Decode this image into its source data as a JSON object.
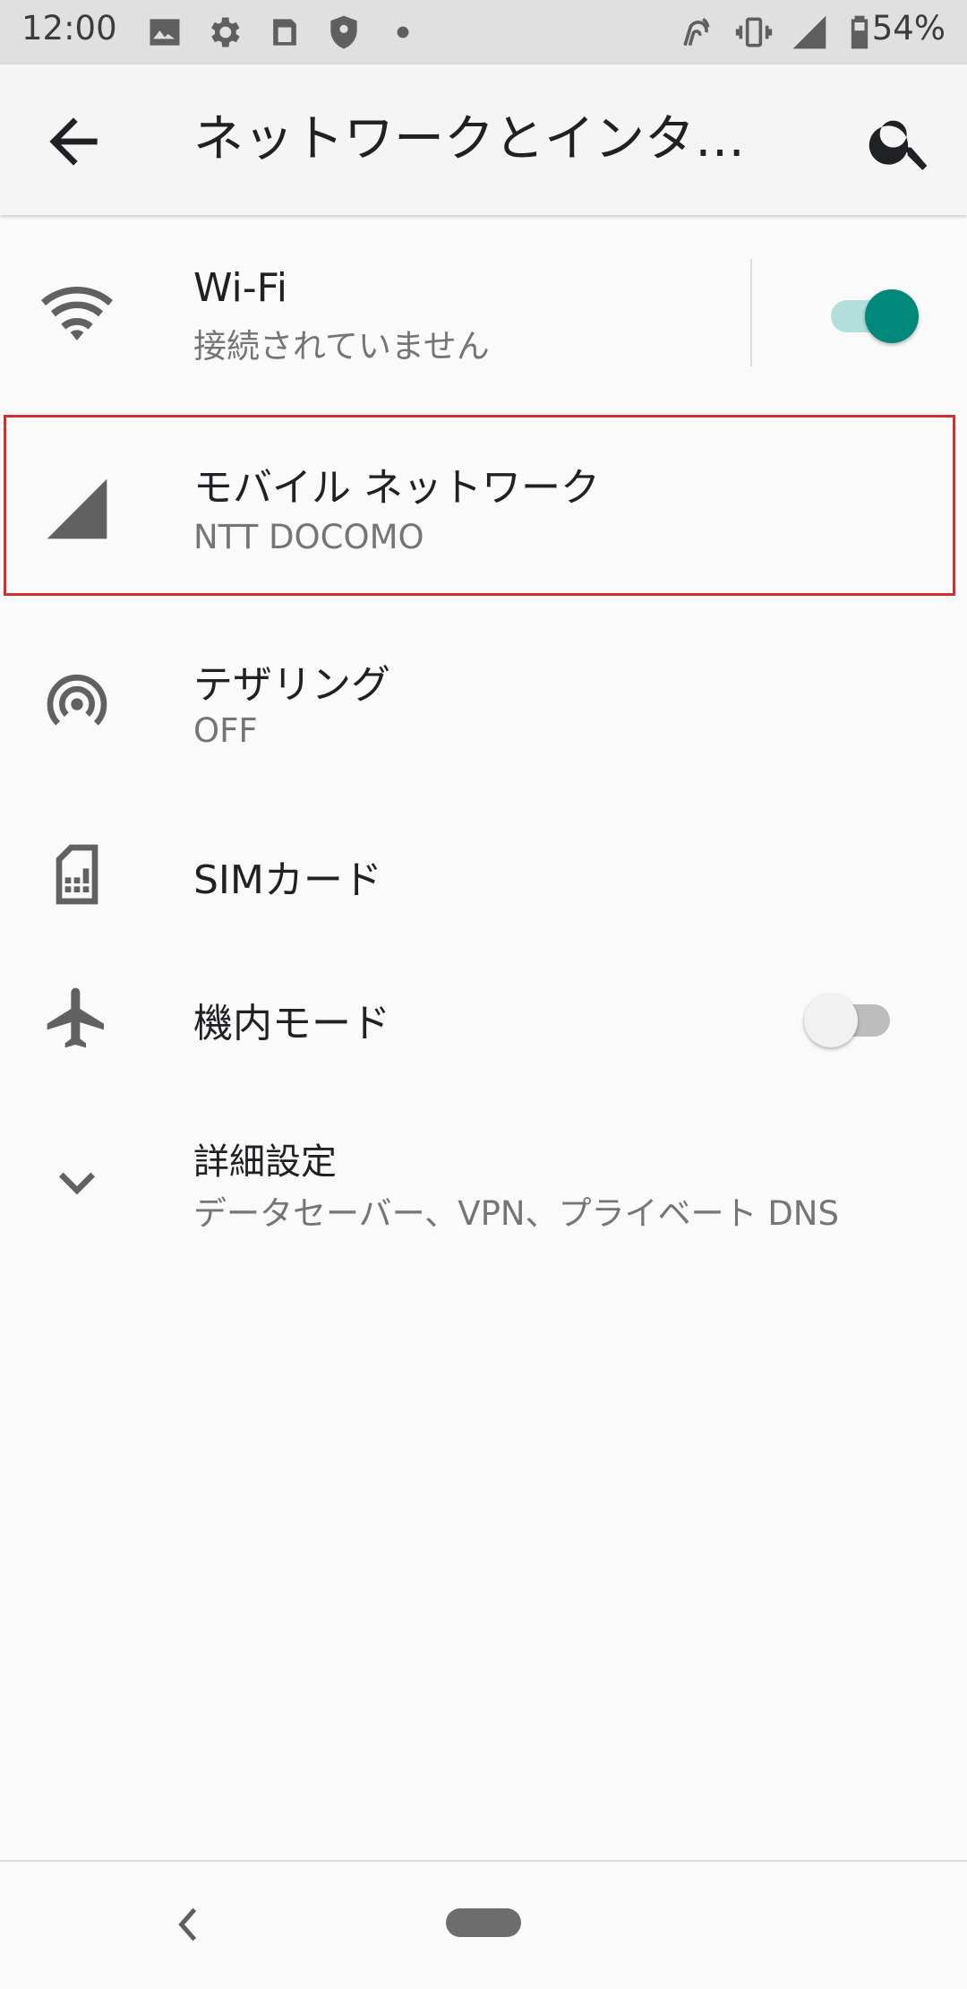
{
  "status_bar": {
    "time": "12:00",
    "battery_percent": "54%",
    "icons": [
      "image-icon",
      "gear-icon",
      "clipboard-icon",
      "shield-icon",
      "dot-icon",
      "nfc-icon",
      "vibrate-icon",
      "signal-icon",
      "battery-icon"
    ]
  },
  "app_bar": {
    "title": "ネットワークとインタ…"
  },
  "rows": {
    "wifi": {
      "title": "Wi-Fi",
      "subtitle": "接続されていません",
      "toggle_on": true
    },
    "mobile": {
      "title": "モバイル ネットワーク",
      "subtitle": "NTT DOCOMO"
    },
    "tethering": {
      "title": "テザリング",
      "subtitle": "OFF"
    },
    "sim": {
      "title": "SIMカード"
    },
    "airplane": {
      "title": "機内モード",
      "toggle_on": false
    },
    "advanced": {
      "title": "詳細設定",
      "subtitle": "データセーバー、VPN、プライベート DNS"
    }
  },
  "colors": {
    "accent": "#00897b",
    "accent_track": "#b2dfdb",
    "icon_gray": "#616161",
    "highlight": "#d32f2f"
  }
}
